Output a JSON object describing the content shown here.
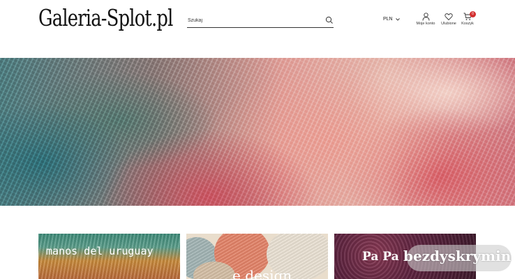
{
  "header": {
    "logo_text": "Galeria-Splot.pl",
    "search": {
      "placeholder": "Szukaj",
      "value": ""
    },
    "currency": "PLN",
    "account_label": "Moje konto",
    "wishlist_label": "Ulubione",
    "cart_label": "Koszyk",
    "cart_count": "0"
  },
  "hero": {
    "icon": "knitted-mohair-photo"
  },
  "categories": [
    {
      "label": "manos del uruguay"
    },
    {
      "label": "e design"
    },
    {
      "label": "Pa Pa"
    }
  ],
  "watermark_text": "bezdyskrymin",
  "colors": {
    "badge": "#d32f2f",
    "text": "#222222",
    "background": "#ffffff"
  }
}
